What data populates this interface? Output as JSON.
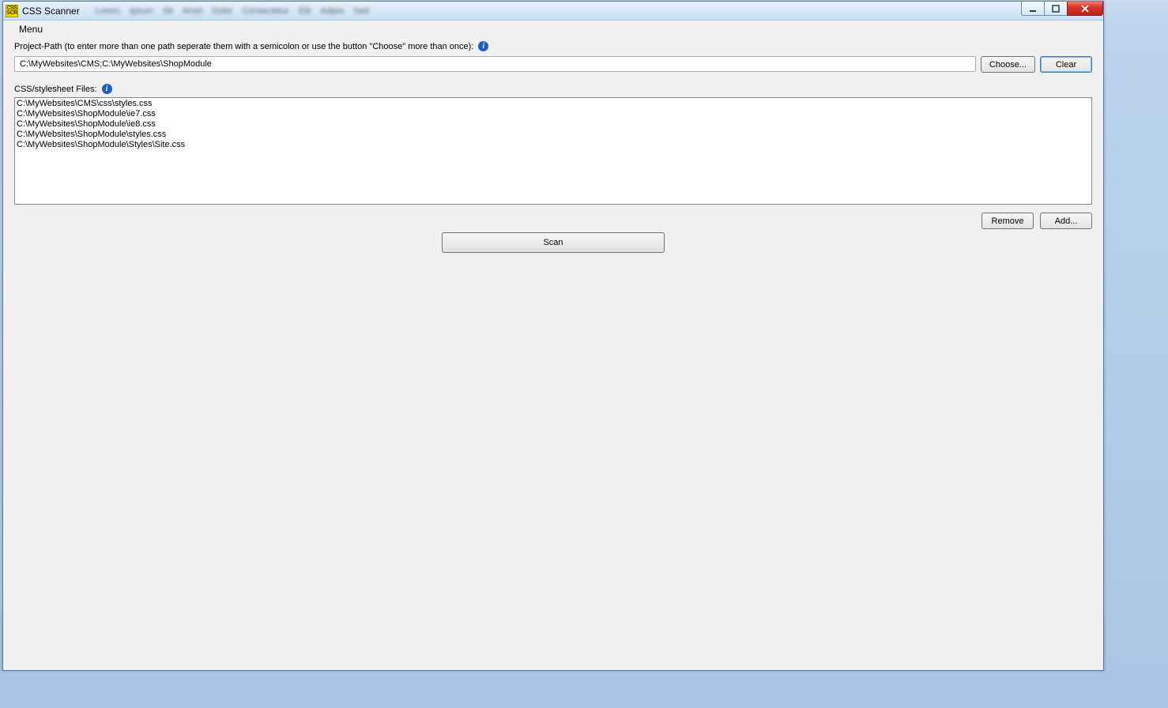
{
  "titlebar": {
    "title": "CSS Scanner",
    "icon_text_top": "CSS",
    "icon_text_bottom": "SCR",
    "blurred_items": [
      "Lorem",
      "Ipsum",
      "Sit",
      "Amet",
      "Dolor",
      "Consectetur",
      "Elit",
      "Adipis",
      "Sed"
    ]
  },
  "menu": {
    "label": "Menu"
  },
  "project_path": {
    "label": "Project-Path (to enter more than one path seperate them with a semicolon or use the button \"Choose\" more than once):",
    "value": "C:\\MyWebsites\\CMS;C:\\MyWebsites\\ShopModule",
    "choose_label": "Choose...",
    "clear_label": "Clear"
  },
  "stylesheets": {
    "label": "CSS/stylesheet Files:",
    "files": [
      "C:\\MyWebsites\\CMS\\css\\styles.css",
      "C:\\MyWebsites\\ShopModule\\ie7.css",
      "C:\\MyWebsites\\ShopModule\\ie8.css",
      "C:\\MyWebsites\\ShopModule\\styles.css",
      "C:\\MyWebsites\\ShopModule\\Styles\\Site.css"
    ],
    "remove_label": "Remove",
    "add_label": "Add..."
  },
  "scan": {
    "label": "Scan"
  }
}
